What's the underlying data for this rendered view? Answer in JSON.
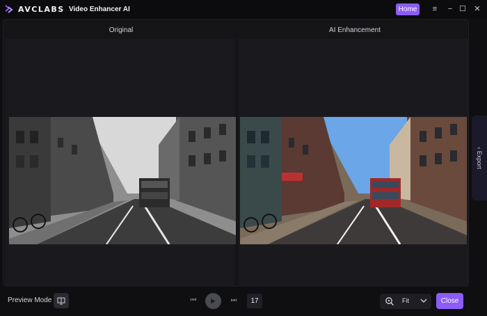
{
  "titlebar": {
    "brand": "AVCLABS",
    "app_name": "Video Enhancer AI",
    "home_label": "Home",
    "menu_icon": "≡",
    "minimize_icon": "−",
    "maximize_icon": "☐",
    "close_icon": "✕"
  },
  "panes": {
    "left_label": "Original",
    "right_label": "AI Enhancement"
  },
  "export_tab": {
    "label": "Export",
    "arrow": "‹"
  },
  "bottombar": {
    "preview_label": "Preview Mode",
    "prev_icon": "⏮",
    "play_icon": "▶",
    "next_icon": "⏭",
    "frame_number": "17",
    "fit_label": "Fit",
    "close_label": "Close"
  },
  "colors": {
    "accent": "#8b5cf6",
    "background": "#0f0f12",
    "panel": "#151518"
  }
}
